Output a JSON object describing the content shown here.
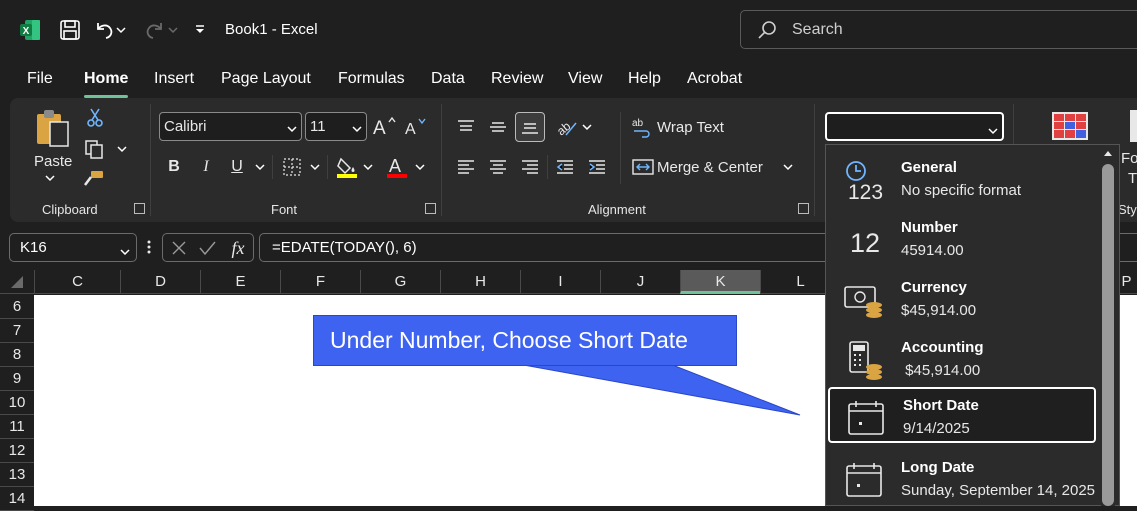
{
  "window": {
    "title": "Book1  -  Excel"
  },
  "search": {
    "placeholder": "Search"
  },
  "tabs": [
    "File",
    "Home",
    "Insert",
    "Page Layout",
    "Formulas",
    "Data",
    "Review",
    "View",
    "Help",
    "Acrobat"
  ],
  "ribbon": {
    "clipboard": {
      "label": "Clipboard",
      "paste": "Paste"
    },
    "font": {
      "label": "Font",
      "name": "Calibri",
      "size": "11",
      "bold": "B",
      "italic": "I",
      "underline": "U"
    },
    "alignment": {
      "label": "Alignment",
      "wrap_text": "Wrap Text",
      "merge_center": "Merge & Center"
    },
    "number": {
      "format_value": ""
    },
    "styles": {
      "fragment1": "Fo",
      "fragment2": "T",
      "fragment3": "Styl"
    }
  },
  "formula_bar": {
    "name_box": "K16",
    "fx": "fx",
    "formula": "=EDATE(TODAY(), 6)"
  },
  "columns": [
    "C",
    "D",
    "E",
    "F",
    "G",
    "H",
    "I",
    "J",
    "K",
    "L",
    "P"
  ],
  "selected_column": "K",
  "rows": [
    "6",
    "7",
    "8",
    "9",
    "10",
    "11",
    "12",
    "13",
    "14"
  ],
  "callout": {
    "text": "Under Number, Choose Short Date",
    "color": "#3e63f0"
  },
  "number_formats": [
    {
      "name": "General",
      "value": "No specific format",
      "icon": "clock-123-icon"
    },
    {
      "name": "Number",
      "value": "45914.00",
      "icon": "number-12-icon"
    },
    {
      "name": "Currency",
      "value": "$45,914.00",
      "icon": "currency-icon"
    },
    {
      "name": "Accounting",
      "value": " $45,914.00",
      "icon": "calculator-icon"
    },
    {
      "name": "Short Date",
      "value": "9/14/2025",
      "icon": "calendar-icon",
      "selected": true
    },
    {
      "name": "Long Date",
      "value": "Sunday, September 14, 2025",
      "icon": "calendar-icon"
    }
  ],
  "icon_glyphs": {
    "general": "123",
    "number": "12"
  },
  "colors": {
    "accent": "#6fc29a",
    "excel_green": "#1d6f42",
    "highlight_yellow": "#ffff00",
    "font_red": "#ff0000"
  }
}
